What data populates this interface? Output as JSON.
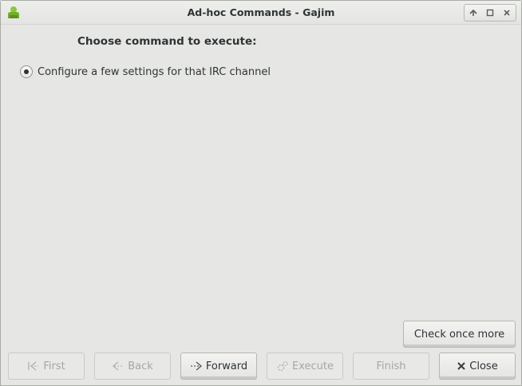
{
  "window": {
    "title": "Ad-hoc Commands - Gajim"
  },
  "wm": {
    "minimize_icon": "minimize-icon",
    "maximize_icon": "maximize-icon",
    "close_icon": "close-icon"
  },
  "content": {
    "heading": "Choose command to execute:",
    "commands": [
      {
        "label": "Configure a few settings for that IRC channel",
        "selected": true
      }
    ]
  },
  "buttons": {
    "check_once_more": "Check once more",
    "first": "First",
    "back": "Back",
    "forward": "Forward",
    "execute": "Execute",
    "finish": "Finish",
    "close": "Close"
  },
  "colors": {
    "app_icon_green": "#73ad2a"
  }
}
